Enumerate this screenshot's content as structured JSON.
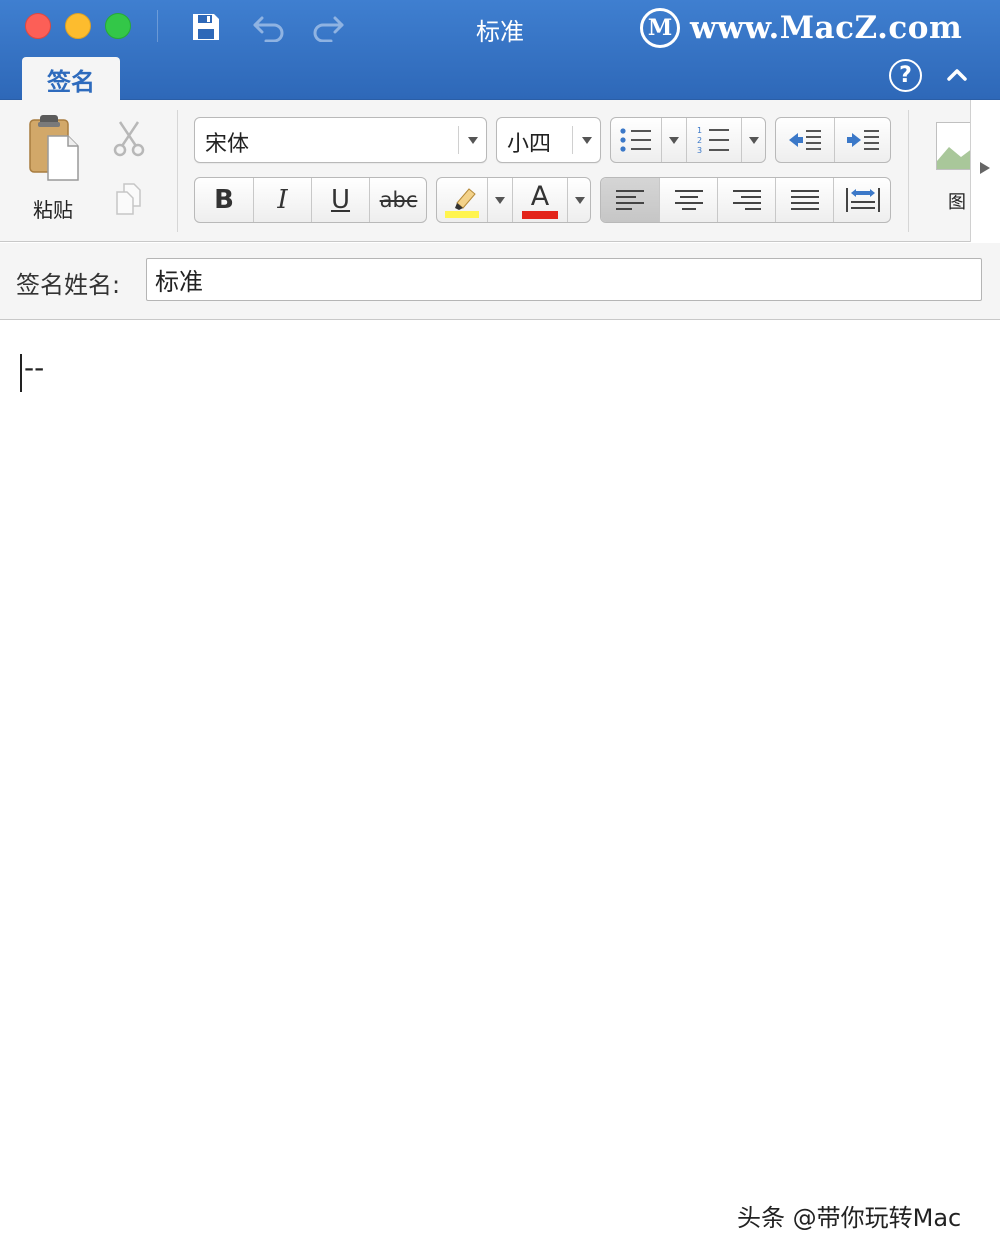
{
  "window": {
    "title": "标准",
    "brand_text": "www.MacZ.com",
    "brand_logo_letter": "M"
  },
  "ribbon": {
    "active_tab": "签名",
    "help_label": "?",
    "clipboard": {
      "paste_label": "粘贴"
    },
    "font": {
      "family": "宋体",
      "size": "小四"
    },
    "format": {
      "bold": "B",
      "italic": "I",
      "underline": "U",
      "strikethrough": "abc",
      "font_color_letter": "A"
    },
    "alignment": {
      "active": "left"
    },
    "colors": {
      "highlight": "#fff44f",
      "font_color": "#e3251b",
      "accent": "#2e6bbd"
    },
    "gallery_label": "图"
  },
  "signature": {
    "name_label": "签名姓名:",
    "name_value": "标准"
  },
  "editor": {
    "content": "--"
  },
  "watermark": "头条 @带你玩转Mac"
}
